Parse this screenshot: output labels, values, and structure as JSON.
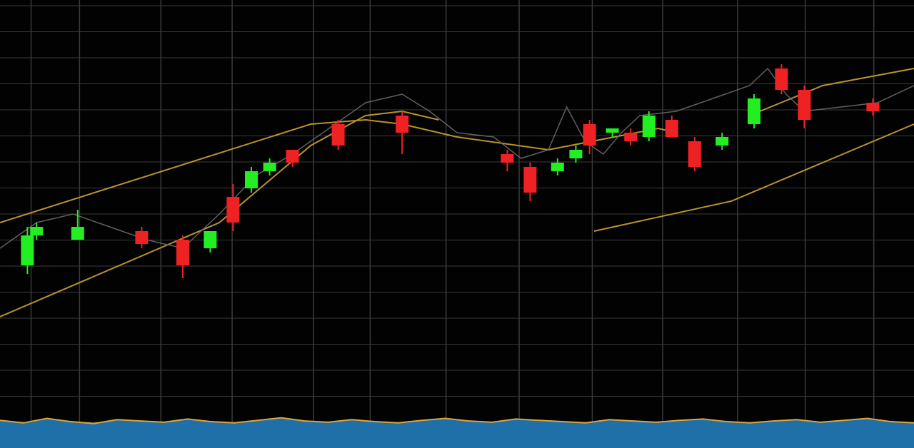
{
  "colors": {
    "background": "#020202",
    "grid": "#3a3a3a",
    "up": "#22ee22",
    "down": "#ee2222",
    "price_line": "#6a6a6a",
    "channel": "#b8922e",
    "volume_fill": "#1f6fa8",
    "volume_edge": "#d9a640"
  },
  "chart_data": {
    "type": "candlestick",
    "title": "",
    "xlabel": "",
    "ylabel": "",
    "grid": true,
    "legend": "none",
    "x_range": [
      0,
      100
    ],
    "y_range": [
      0,
      100
    ],
    "candles": [
      {
        "x": 3,
        "open": 38,
        "close": 45,
        "high": 47,
        "low": 36
      },
      {
        "x": 4,
        "open": 45,
        "close": 47,
        "high": 48,
        "low": 44
      },
      {
        "x": 8.5,
        "open": 44,
        "close": 47,
        "high": 51,
        "low": 44
      },
      {
        "x": 15.5,
        "open": 46,
        "close": 43,
        "high": 47,
        "low": 42
      },
      {
        "x": 20,
        "open": 44,
        "close": 38,
        "high": 45,
        "low": 35
      },
      {
        "x": 23,
        "open": 42,
        "close": 46,
        "high": 46,
        "low": 41
      },
      {
        "x": 25.5,
        "open": 54,
        "close": 48,
        "high": 57,
        "low": 46
      },
      {
        "x": 27.5,
        "open": 56,
        "close": 60,
        "high": 61,
        "low": 55
      },
      {
        "x": 29.5,
        "open": 60,
        "close": 62,
        "high": 63,
        "low": 59
      },
      {
        "x": 32,
        "open": 65,
        "close": 62,
        "high": 65,
        "low": 61
      },
      {
        "x": 37,
        "open": 71,
        "close": 66,
        "high": 72,
        "low": 65
      },
      {
        "x": 44,
        "open": 73,
        "close": 69,
        "high": 74,
        "low": 64
      },
      {
        "x": 55.5,
        "open": 64,
        "close": 62,
        "high": 65,
        "low": 60
      },
      {
        "x": 58,
        "open": 61,
        "close": 55,
        "high": 62,
        "low": 53
      },
      {
        "x": 61,
        "open": 60,
        "close": 62,
        "high": 63,
        "low": 59
      },
      {
        "x": 63,
        "open": 63,
        "close": 65,
        "high": 66,
        "low": 62
      },
      {
        "x": 64.5,
        "open": 71,
        "close": 66,
        "high": 72,
        "low": 64
      },
      {
        "x": 67,
        "open": 69,
        "close": 70,
        "high": 70,
        "low": 68
      },
      {
        "x": 69,
        "open": 69,
        "close": 67,
        "high": 70,
        "low": 66
      },
      {
        "x": 71,
        "open": 68,
        "close": 73,
        "high": 74,
        "low": 67
      },
      {
        "x": 73.5,
        "open": 72,
        "close": 68,
        "high": 73,
        "low": 68
      },
      {
        "x": 76,
        "open": 67,
        "close": 61,
        "high": 68,
        "low": 60
      },
      {
        "x": 79,
        "open": 66,
        "close": 68,
        "high": 69,
        "low": 65
      },
      {
        "x": 82.5,
        "open": 71,
        "close": 77,
        "high": 78,
        "low": 70
      },
      {
        "x": 85.5,
        "open": 84,
        "close": 79,
        "high": 85,
        "low": 78
      },
      {
        "x": 88,
        "open": 79,
        "close": 72,
        "high": 80,
        "low": 70
      },
      {
        "x": 95.5,
        "open": 76,
        "close": 74,
        "high": 77,
        "low": 73
      }
    ],
    "price_line": [
      [
        0,
        42
      ],
      [
        4,
        48
      ],
      [
        8,
        50
      ],
      [
        12,
        47
      ],
      [
        16,
        44
      ],
      [
        20,
        42
      ],
      [
        24,
        50
      ],
      [
        28,
        59
      ],
      [
        32,
        64
      ],
      [
        36,
        70
      ],
      [
        40,
        76
      ],
      [
        44,
        78
      ],
      [
        47,
        74
      ],
      [
        50,
        69
      ],
      [
        54,
        68
      ],
      [
        57,
        63
      ],
      [
        60,
        65
      ],
      [
        62,
        75
      ],
      [
        64,
        67
      ],
      [
        66,
        64
      ],
      [
        68,
        69
      ],
      [
        70,
        73
      ],
      [
        74,
        74
      ],
      [
        78,
        77
      ],
      [
        82,
        80
      ],
      [
        84,
        84
      ],
      [
        86,
        78
      ],
      [
        88,
        74
      ],
      [
        92,
        75
      ],
      [
        96,
        76
      ],
      [
        100,
        80
      ]
    ],
    "channel_lines": [
      {
        "points": [
          [
            0,
            48
          ],
          [
            34,
            71
          ],
          [
            40,
            72
          ],
          [
            44,
            71
          ],
          [
            50,
            68
          ],
          [
            60,
            65
          ],
          [
            72,
            70
          ],
          [
            74,
            69
          ]
        ]
      },
      {
        "points": [
          [
            0,
            26
          ],
          [
            24,
            48
          ],
          [
            34,
            66
          ],
          [
            40,
            73
          ],
          [
            44,
            74
          ],
          [
            48,
            72
          ]
        ]
      },
      {
        "points": [
          [
            65,
            46
          ],
          [
            80,
            53
          ],
          [
            100,
            71
          ]
        ]
      },
      {
        "points": [
          [
            82,
            73
          ],
          [
            90,
            80
          ],
          [
            100,
            84
          ]
        ]
      }
    ],
    "volume": [
      22,
      18,
      25,
      20,
      17,
      23,
      21,
      19,
      24,
      20,
      18,
      22,
      26,
      21,
      19,
      23,
      20,
      18,
      22,
      25,
      21,
      19,
      24,
      22,
      20,
      18,
      23,
      21,
      19,
      22,
      24,
      20,
      18,
      21,
      23,
      19,
      22,
      25,
      20,
      18
    ]
  }
}
